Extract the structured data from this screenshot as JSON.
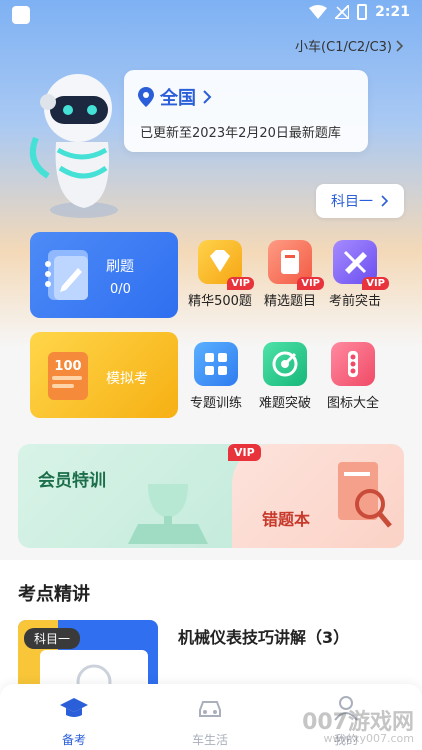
{
  "status": {
    "time": "2:21"
  },
  "header": {
    "car_type": "小车(C1/C2/C3)"
  },
  "location": {
    "region": "全国",
    "update_text": "已更新至2023年2月20日最新题库"
  },
  "subject_button": {
    "label": "科目一"
  },
  "tiles": {
    "practice": {
      "title": "刷题",
      "progress": "0/0"
    },
    "mock": {
      "title": "模拟考",
      "icon_text": "100"
    }
  },
  "grid": [
    {
      "label": "精华500题",
      "vip": "VIP"
    },
    {
      "label": "精选题目",
      "vip": "VIP"
    },
    {
      "label": "考前突击",
      "vip": "VIP"
    },
    {
      "label": "专题训练"
    },
    {
      "label": "难题突破"
    },
    {
      "label": "图标大全"
    }
  ],
  "member": {
    "title": "会员特训",
    "vip": "VIP",
    "wrong_book": "错题本"
  },
  "section": {
    "title": "考点精讲",
    "lesson": {
      "badge": "科目一",
      "title": "机械仪表技巧讲解（3）"
    }
  },
  "tabs": [
    {
      "label": "备考"
    },
    {
      "label": "车生活"
    },
    {
      "label": "我的"
    }
  ],
  "watermark": {
    "main": "007游戏网",
    "sub": "www.xy007.com"
  },
  "colors": {
    "accent": "#2b5fd9",
    "vip": "#e8323c",
    "practice": "#2f6ff0",
    "mock": "#f6b013"
  }
}
